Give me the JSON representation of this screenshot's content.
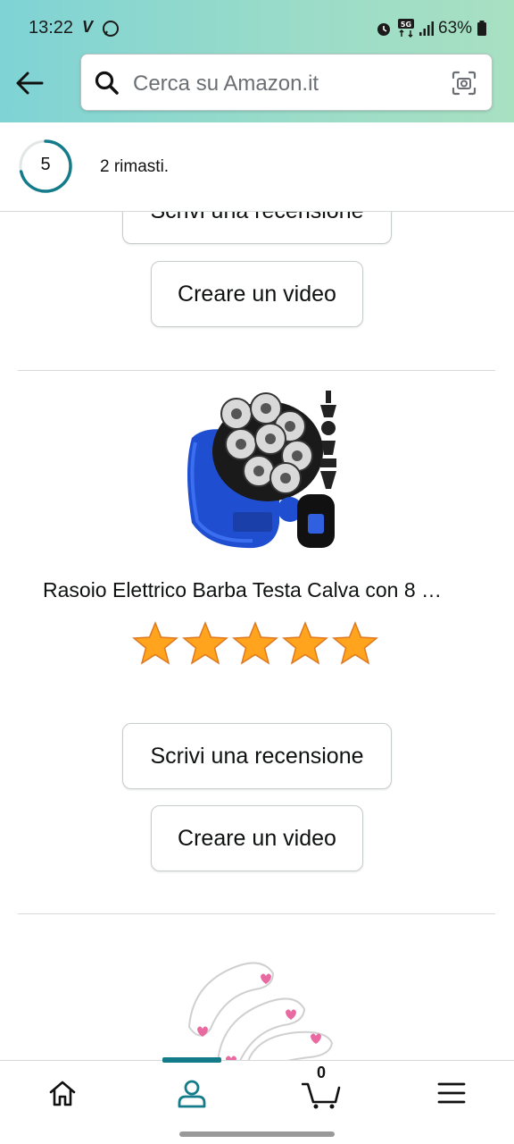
{
  "status_bar": {
    "time": "13:22",
    "battery": "63%"
  },
  "search": {
    "placeholder": "Cerca su Amazon.it"
  },
  "progress": {
    "count": "5",
    "remaining_text": "2 rimasti."
  },
  "actions": {
    "write_review": "Scrivi una recensione",
    "create_video": "Creare un video"
  },
  "product": {
    "title": "Rasoio Elettrico Barba Testa Calva con 8 …",
    "rating_stars": 5
  },
  "bottom_nav": {
    "cart_count": "0"
  },
  "colors": {
    "header_gradient_start": "#7fd3d5",
    "header_gradient_end": "#a8e0c2",
    "accent": "#137b8a",
    "star": "#ffa41c"
  },
  "icons": [
    "back-arrow-icon",
    "search-icon",
    "camera-scan-icon",
    "home-icon",
    "account-icon",
    "cart-icon",
    "menu-icon",
    "star-icon"
  ]
}
